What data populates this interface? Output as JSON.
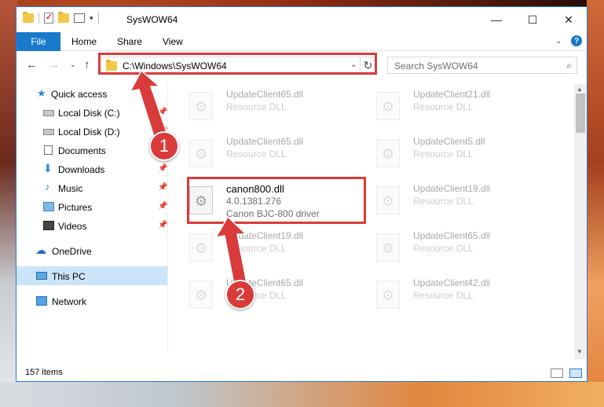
{
  "window": {
    "title": "SysWOW64",
    "controls": {
      "minimize": "—",
      "maximize": "☐",
      "close": "✕"
    }
  },
  "ribbon": {
    "tabs": [
      "File",
      "Home",
      "Share",
      "View"
    ]
  },
  "navigation": {
    "back": "←",
    "forward": "→",
    "recent": "⌄",
    "up": "↑",
    "address": "C:\\Windows\\SysWOW64",
    "refresh": "↻",
    "search_placeholder": "Search SysWOW64",
    "search_icon": "⌕"
  },
  "sidebar": {
    "items": [
      {
        "label": "Quick access",
        "icon": "star-icon"
      },
      {
        "label": "Local Disk (C:)",
        "icon": "disk-icon",
        "pinned": true
      },
      {
        "label": "Local Disk (D:)",
        "icon": "disk-icon",
        "pinned": true
      },
      {
        "label": "Documents",
        "icon": "documents-icon",
        "pinned": true
      },
      {
        "label": "Downloads",
        "icon": "downloads-icon",
        "pinned": true
      },
      {
        "label": "Music",
        "icon": "music-icon",
        "pinned": true
      },
      {
        "label": "Pictures",
        "icon": "pictures-icon",
        "pinned": true
      },
      {
        "label": "Videos",
        "icon": "videos-icon",
        "pinned": true
      },
      {
        "label": "OneDrive",
        "icon": "onedrive-icon"
      },
      {
        "label": "This PC",
        "icon": "this-pc-icon",
        "selected": true
      },
      {
        "label": "Network",
        "icon": "network-icon"
      }
    ]
  },
  "files": [
    {
      "name": "UpdateClient65.dll",
      "desc": "Resource DLL"
    },
    {
      "name": "UpdateClient21.dll",
      "desc": "Resource DLL"
    },
    {
      "name": "UpdateClient65.dll",
      "desc": "Resource DLL"
    },
    {
      "name": "UpdateClient5.dll",
      "desc": "Resource DLL"
    },
    {
      "name": "canon800.dll",
      "version": "4.0.1381.276",
      "desc": "Canon BJC-800 driver",
      "selected": true
    },
    {
      "name": "UpdateClient19.dll",
      "desc": "Resource DLL"
    },
    {
      "name": "UpdateClient19.dll",
      "desc": "Resource DLL"
    },
    {
      "name": "UpdateClient65.dll",
      "desc": "Resource DLL"
    },
    {
      "name": "UpdateClient65.dll",
      "desc": "Resource DLL"
    },
    {
      "name": "UpdateClient42.dll",
      "desc": "Resource DLL"
    }
  ],
  "status": {
    "item_count": "157 items"
  },
  "annotations": {
    "step1": "1",
    "step2": "2",
    "highlight_color": "#d93b3b"
  },
  "colors": {
    "accent": "#1979ca",
    "selection": "#cce4f7"
  }
}
